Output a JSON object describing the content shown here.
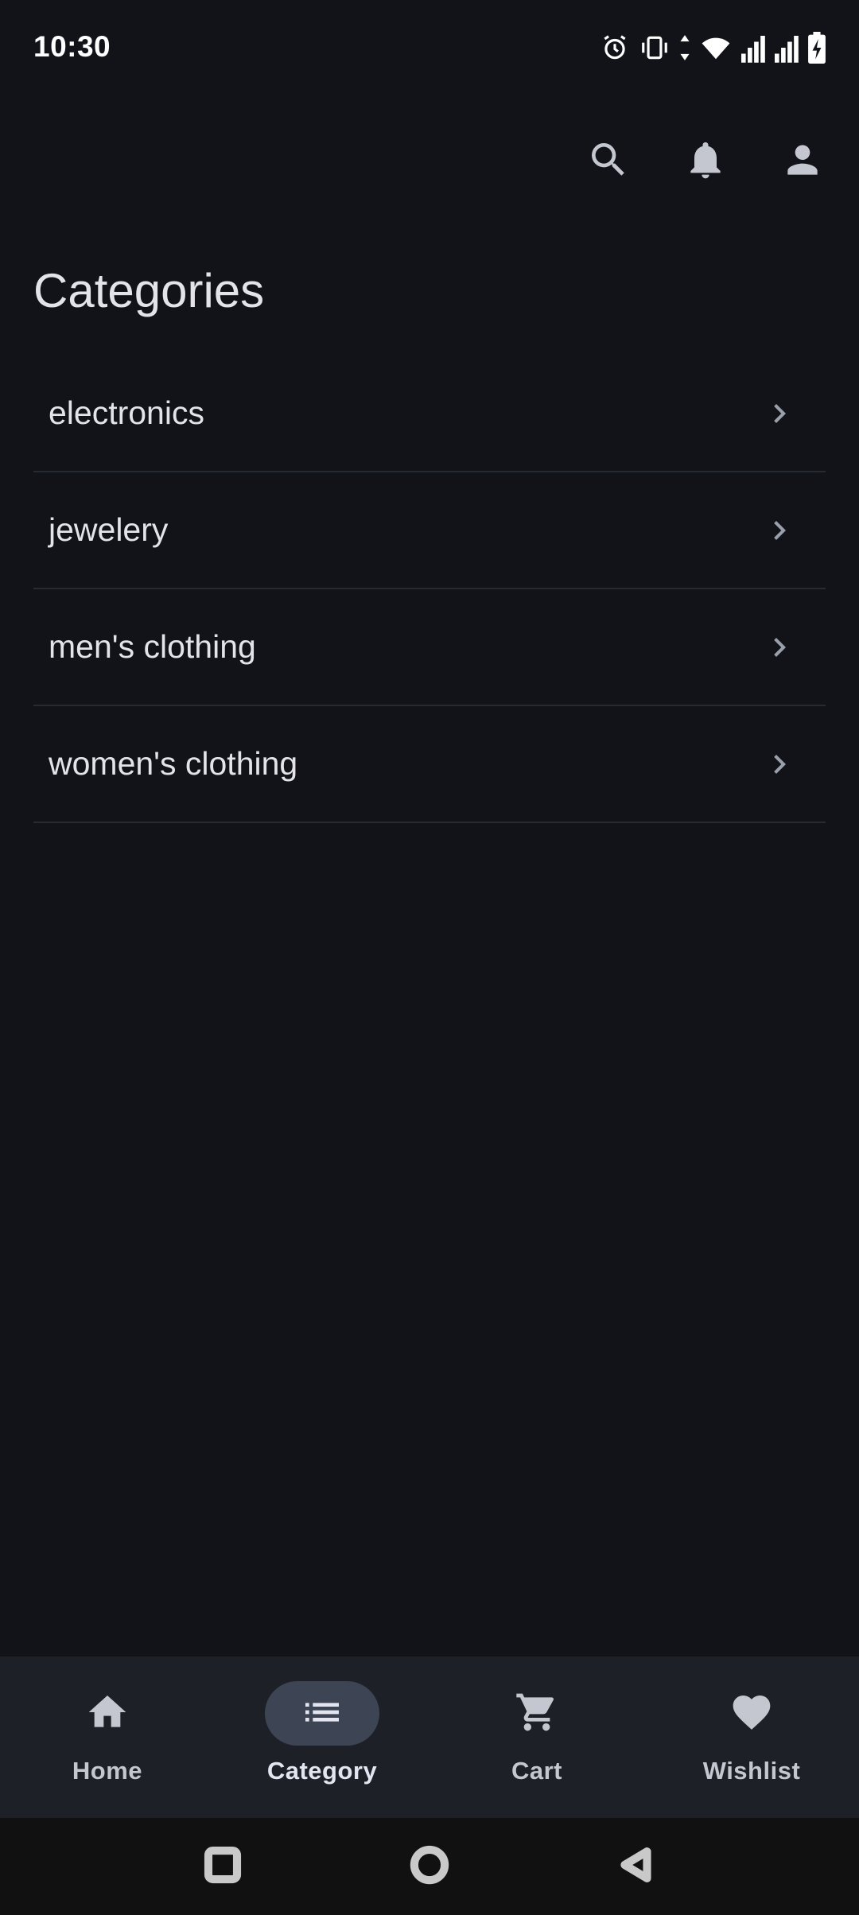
{
  "status_bar": {
    "time": "10:30",
    "icons": [
      "alarm-icon",
      "vibrate-icon",
      "data-arrows-icon",
      "wifi-icon",
      "signal-icon",
      "signal-icon",
      "battery-charging-icon"
    ]
  },
  "top_actions": {
    "icons": [
      "search-icon",
      "notifications-icon",
      "account-icon"
    ]
  },
  "page": {
    "title": "Categories"
  },
  "categories": [
    {
      "label": "electronics"
    },
    {
      "label": "jewelery"
    },
    {
      "label": "men's clothing"
    },
    {
      "label": "women's clothing"
    }
  ],
  "bottom_nav": {
    "items": [
      {
        "label": "Home",
        "icon": "home-icon",
        "active": false
      },
      {
        "label": "Category",
        "icon": "list-icon",
        "active": true
      },
      {
        "label": "Cart",
        "icon": "cart-icon",
        "active": false
      },
      {
        "label": "Wishlist",
        "icon": "heart-icon",
        "active": false
      }
    ]
  },
  "system_nav": {
    "buttons": [
      "recents-button",
      "home-button",
      "back-button"
    ]
  },
  "colors": {
    "background": "#111319",
    "surface": "#1d2027",
    "active_pill": "#3d4453",
    "text_primary": "#e3e3e8",
    "icon": "#c4c7d0",
    "divider": "#252a33"
  }
}
